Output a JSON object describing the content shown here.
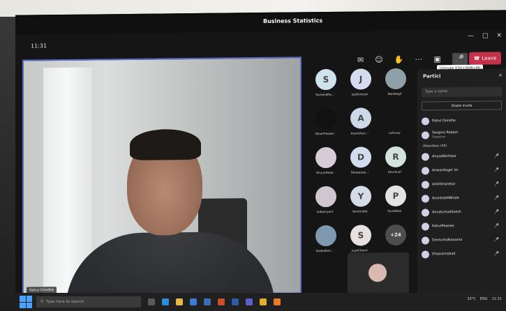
{
  "app": {
    "clock": "11:31",
    "title": "Business Statistics",
    "tooltip": "Unmute (Ctrl+Shift+M)",
    "leave_label": "Leave"
  },
  "main_video": {
    "name": "Rahul Dondhe"
  },
  "grid": [
    {
      "initial": "S",
      "label": "SumandRa... ̀",
      "bg": "#cfe3ee"
    },
    {
      "initial": "J",
      "label": "JayBoreuta ̀",
      "bg": "#d6dcef"
    },
    {
      "initial": "",
      "label": "Nacblege ̀",
      "bg": "#8fa0a8"
    },
    {
      "initial": "",
      "label": "DeiuiPrasoev ̀",
      "bg": "#111111"
    },
    {
      "initial": "A",
      "label": "AvantAuki... ̀",
      "bg": "#cdd9e6"
    },
    {
      "initial": "",
      "label": "Iulhivey ̀",
      "bg": "#141414"
    },
    {
      "initial": "",
      "label": "RinumPalse ̀",
      "bg": "#d7cbd5"
    },
    {
      "initial": "D",
      "label": "Deswaiula... ̀",
      "bg": "#d2dced"
    },
    {
      "initial": "R",
      "label": "Stunhuol ̀",
      "bg": "#d3e2df"
    },
    {
      "initial": "",
      "label": "Indoeriyam ̀",
      "bg": "#cfc6d0"
    },
    {
      "initial": "Y",
      "label": "YarsUcdda ̀",
      "bg": "#d4dbe9"
    },
    {
      "initial": "P",
      "label": "PundDaiu ̀",
      "bg": "#e3e3e3"
    },
    {
      "initial": "",
      "label": "Andiolfam... ̀",
      "bg": "#7f9aae"
    },
    {
      "initial": "S",
      "label": "JuydCharm ̀",
      "bg": "#e6e0e0"
    },
    {
      "initial": "+24",
      "label": "",
      "bg": "#4d4d4d"
    }
  ],
  "panel": {
    "title": "Partici",
    "close": "✕",
    "search_placeholder": "Type a name",
    "share_label": "Share invite",
    "top": [
      {
        "name": "Rahul Dondhe",
        "sub": ""
      },
      {
        "name": "Swapna Radam",
        "sub": "Organizer"
      }
    ],
    "section_label": "Attendees (49)",
    "attendees": [
      "AnyadAkrhwar",
      "AnwanKoger Vs",
      "Ankitkharekar",
      "AvonbdaMBhide",
      "AmuKumadSaksh",
      "RahulPewsee",
      "DevtushaNasasna",
      "Dhasutmsbad"
    ]
  },
  "taskbar": {
    "search_placeholder": "Type here to search",
    "tray_temp": "33°C",
    "tray_time": "11:31",
    "tray_lang": "ENG"
  }
}
